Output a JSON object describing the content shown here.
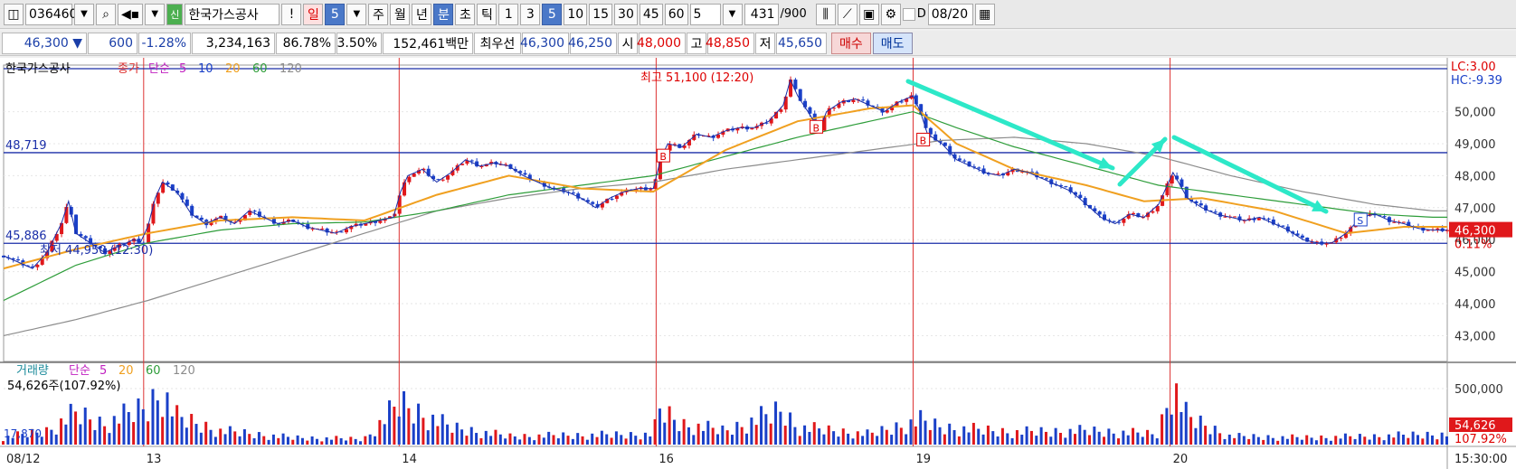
{
  "toolbar": {
    "code": "036460",
    "name": "한국가스공사",
    "name_badge": "신",
    "alert": "!",
    "period_day": "일",
    "period_num": "5",
    "period_week": "주",
    "period_month": "월",
    "period_year": "년",
    "period_min": "분",
    "period_sec": "초",
    "period_tick": "틱",
    "intervals": [
      "1",
      "3",
      "5",
      "10",
      "15",
      "30",
      "45",
      "60"
    ],
    "interval_selected": "5",
    "count": "5",
    "bars": "431",
    "bars_total": "/900",
    "d_label": "D",
    "date": "08/20"
  },
  "quote": {
    "price": "46,300",
    "arrow": "▼",
    "change": "600",
    "change_pct": "-1.28%",
    "volume": "3,234,163",
    "vol_ratio": "86.78%",
    "turnover": "3.50%",
    "amount": "152,461백만",
    "best_label": "최우선",
    "best_ask": "46,300",
    "best_bid": "46,250",
    "open_label": "시",
    "open": "48,000",
    "high_label": "고",
    "high": "48,850",
    "low_label": "저",
    "low": "45,650",
    "buy": "매수",
    "sell": "매도"
  },
  "chart_data": {
    "type": "candlestick",
    "legend": {
      "name": "한국가스공사",
      "price_type": "종가",
      "ma_type": "단순",
      "ma_periods": [
        "5",
        "10",
        "20",
        "60",
        "120"
      ]
    },
    "volume_legend": {
      "name": "거래량",
      "ma_type": "단순",
      "ma_periods": [
        "5",
        "20",
        "60",
        "120"
      ],
      "current": "54,626주(107.92%)",
      "left_value": "17,870"
    },
    "y_ticks": [
      "50,000",
      "49,000",
      "48,000",
      "47,000",
      "46,000",
      "45,000",
      "44,000",
      "43,000"
    ],
    "y_values": [
      50000,
      49000,
      48000,
      47000,
      46000,
      45000,
      44000,
      43000
    ],
    "ylim": [
      42250,
      51400
    ],
    "volume_ticks": [
      "500,000"
    ],
    "lc": "LC:3.00",
    "hc": "HC:-9.39",
    "current_price": "46,300",
    "current_pct": "0.11%",
    "vol_current": "54,626",
    "vol_current_pct": "107.92%",
    "hline_upper_label": "48,719",
    "hline_upper": 48719,
    "hline_lower_label": "45,886",
    "hline_lower": 45886,
    "high_note": "최고 51,100 (12:20)",
    "low_note": "최저 44,950 (12:30)",
    "x_labels": [
      "08/12",
      "13",
      "14",
      "16",
      "19",
      "20"
    ],
    "time_label": "15:30:00",
    "day_starts": [
      0,
      0.097,
      0.274,
      0.452,
      0.63,
      0.808
    ],
    "price_path": [
      [
        0,
        45500
      ],
      [
        0.01,
        45300
      ],
      [
        0.02,
        45100
      ],
      [
        0.03,
        45600
      ],
      [
        0.04,
        46500
      ],
      [
        0.045,
        47200
      ],
      [
        0.05,
        46200
      ],
      [
        0.06,
        45900
      ],
      [
        0.07,
        45600
      ],
      [
        0.08,
        45800
      ],
      [
        0.09,
        46000
      ],
      [
        0.097,
        45900
      ],
      [
        0.105,
        47300
      ],
      [
        0.11,
        47800
      ],
      [
        0.12,
        47500
      ],
      [
        0.13,
        46800
      ],
      [
        0.14,
        46500
      ],
      [
        0.15,
        46700
      ],
      [
        0.16,
        46500
      ],
      [
        0.17,
        46900
      ],
      [
        0.18,
        46700
      ],
      [
        0.19,
        46500
      ],
      [
        0.2,
        46600
      ],
      [
        0.21,
        46400
      ],
      [
        0.22,
        46300
      ],
      [
        0.23,
        46200
      ],
      [
        0.24,
        46400
      ],
      [
        0.25,
        46500
      ],
      [
        0.26,
        46600
      ],
      [
        0.27,
        46700
      ],
      [
        0.275,
        47500
      ],
      [
        0.28,
        48000
      ],
      [
        0.29,
        48200
      ],
      [
        0.3,
        47800
      ],
      [
        0.31,
        48100
      ],
      [
        0.32,
        48500
      ],
      [
        0.33,
        48300
      ],
      [
        0.34,
        48400
      ],
      [
        0.35,
        48300
      ],
      [
        0.36,
        48000
      ],
      [
        0.37,
        47800
      ],
      [
        0.38,
        47600
      ],
      [
        0.39,
        47500
      ],
      [
        0.4,
        47300
      ],
      [
        0.41,
        47000
      ],
      [
        0.42,
        47300
      ],
      [
        0.43,
        47500
      ],
      [
        0.44,
        47600
      ],
      [
        0.45,
        47600
      ],
      [
        0.455,
        48500
      ],
      [
        0.46,
        49000
      ],
      [
        0.47,
        48900
      ],
      [
        0.48,
        49300
      ],
      [
        0.49,
        49200
      ],
      [
        0.5,
        49400
      ],
      [
        0.51,
        49500
      ],
      [
        0.52,
        49500
      ],
      [
        0.53,
        49700
      ],
      [
        0.54,
        50200
      ],
      [
        0.545,
        51000
      ],
      [
        0.55,
        50500
      ],
      [
        0.56,
        49800
      ],
      [
        0.565,
        49400
      ],
      [
        0.57,
        50000
      ],
      [
        0.58,
        50300
      ],
      [
        0.59,
        50400
      ],
      [
        0.6,
        50200
      ],
      [
        0.61,
        50000
      ],
      [
        0.62,
        50300
      ],
      [
        0.63,
        50500
      ],
      [
        0.635,
        50000
      ],
      [
        0.64,
        49300
      ],
      [
        0.65,
        49000
      ],
      [
        0.66,
        48500
      ],
      [
        0.67,
        48300
      ],
      [
        0.68,
        48100
      ],
      [
        0.69,
        48000
      ],
      [
        0.7,
        48200
      ],
      [
        0.71,
        48100
      ],
      [
        0.72,
        47900
      ],
      [
        0.73,
        47700
      ],
      [
        0.74,
        47500
      ],
      [
        0.75,
        47100
      ],
      [
        0.76,
        46700
      ],
      [
        0.77,
        46500
      ],
      [
        0.78,
        46800
      ],
      [
        0.79,
        46700
      ],
      [
        0.8,
        47100
      ],
      [
        0.81,
        48100
      ],
      [
        0.815,
        47700
      ],
      [
        0.82,
        47300
      ],
      [
        0.83,
        47000
      ],
      [
        0.84,
        46800
      ],
      [
        0.85,
        46700
      ],
      [
        0.86,
        46600
      ],
      [
        0.87,
        46700
      ],
      [
        0.88,
        46500
      ],
      [
        0.89,
        46300
      ],
      [
        0.9,
        46000
      ],
      [
        0.91,
        45900
      ],
      [
        0.92,
        45900
      ],
      [
        0.93,
        46200
      ],
      [
        0.94,
        46700
      ],
      [
        0.95,
        46800
      ],
      [
        0.96,
        46600
      ],
      [
        0.97,
        46500
      ],
      [
        0.98,
        46350
      ],
      [
        0.99,
        46300
      ]
    ],
    "ma20_path": [
      [
        0,
        45100
      ],
      [
        0.05,
        45700
      ],
      [
        0.1,
        46200
      ],
      [
        0.15,
        46600
      ],
      [
        0.2,
        46700
      ],
      [
        0.25,
        46600
      ],
      [
        0.3,
        47400
      ],
      [
        0.35,
        48000
      ],
      [
        0.4,
        47600
      ],
      [
        0.45,
        47500
      ],
      [
        0.5,
        48800
      ],
      [
        0.55,
        49700
      ],
      [
        0.6,
        50100
      ],
      [
        0.63,
        50200
      ],
      [
        0.66,
        49000
      ],
      [
        0.7,
        48200
      ],
      [
        0.75,
        47700
      ],
      [
        0.79,
        47200
      ],
      [
        0.83,
        47300
      ],
      [
        0.88,
        46900
      ],
      [
        0.93,
        46200
      ],
      [
        0.97,
        46400
      ],
      [
        0.99,
        46400
      ]
    ],
    "ma60_path": [
      [
        0,
        44100
      ],
      [
        0.05,
        45200
      ],
      [
        0.1,
        45900
      ],
      [
        0.15,
        46300
      ],
      [
        0.2,
        46500
      ],
      [
        0.25,
        46550
      ],
      [
        0.3,
        46900
      ],
      [
        0.35,
        47400
      ],
      [
        0.4,
        47700
      ],
      [
        0.45,
        48000
      ],
      [
        0.5,
        48600
      ],
      [
        0.55,
        49200
      ],
      [
        0.6,
        49700
      ],
      [
        0.63,
        50000
      ],
      [
        0.66,
        49500
      ],
      [
        0.7,
        48900
      ],
      [
        0.75,
        48300
      ],
      [
        0.8,
        47700
      ],
      [
        0.85,
        47400
      ],
      [
        0.9,
        47100
      ],
      [
        0.95,
        46800
      ],
      [
        0.99,
        46700
      ]
    ],
    "ma120_path": [
      [
        0,
        43000
      ],
      [
        0.05,
        43500
      ],
      [
        0.1,
        44100
      ],
      [
        0.15,
        44800
      ],
      [
        0.2,
        45500
      ],
      [
        0.25,
        46200
      ],
      [
        0.3,
        46900
      ],
      [
        0.35,
        47300
      ],
      [
        0.4,
        47600
      ],
      [
        0.45,
        47800
      ],
      [
        0.5,
        48200
      ],
      [
        0.55,
        48500
      ],
      [
        0.6,
        48800
      ],
      [
        0.65,
        49100
      ],
      [
        0.7,
        49200
      ],
      [
        0.75,
        49000
      ],
      [
        0.8,
        48600
      ],
      [
        0.85,
        48000
      ],
      [
        0.9,
        47500
      ],
      [
        0.95,
        47100
      ],
      [
        0.99,
        46900
      ]
    ],
    "volume_path": [
      [
        0,
        0.1
      ],
      [
        0.03,
        0.2
      ],
      [
        0.05,
        0.45
      ],
      [
        0.07,
        0.3
      ],
      [
        0.1,
        0.55
      ],
      [
        0.11,
        0.8
      ],
      [
        0.12,
        0.4
      ],
      [
        0.15,
        0.2
      ],
      [
        0.2,
        0.1
      ],
      [
        0.25,
        0.08
      ],
      [
        0.275,
        0.6
      ],
      [
        0.29,
        0.45
      ],
      [
        0.31,
        0.25
      ],
      [
        0.35,
        0.12
      ],
      [
        0.45,
        0.15
      ],
      [
        0.455,
        0.5
      ],
      [
        0.47,
        0.3
      ],
      [
        0.5,
        0.2
      ],
      [
        0.54,
        0.5
      ],
      [
        0.55,
        0.25
      ],
      [
        0.6,
        0.15
      ],
      [
        0.635,
        0.35
      ],
      [
        0.65,
        0.25
      ],
      [
        0.7,
        0.18
      ],
      [
        0.75,
        0.2
      ],
      [
        0.8,
        0.15
      ],
      [
        0.81,
        0.9
      ],
      [
        0.82,
        0.4
      ],
      [
        0.85,
        0.12
      ],
      [
        0.9,
        0.1
      ],
      [
        0.95,
        0.12
      ],
      [
        0.99,
        0.15
      ]
    ],
    "markers": [
      {
        "label": "B",
        "x": 0.563,
        "y": 49500
      },
      {
        "label": "B",
        "x": 0.457,
        "y": 48600
      },
      {
        "label": "B",
        "x": 0.637,
        "y": 49100
      },
      {
        "label": "S",
        "x": 0.94,
        "y": 46600
      }
    ]
  }
}
